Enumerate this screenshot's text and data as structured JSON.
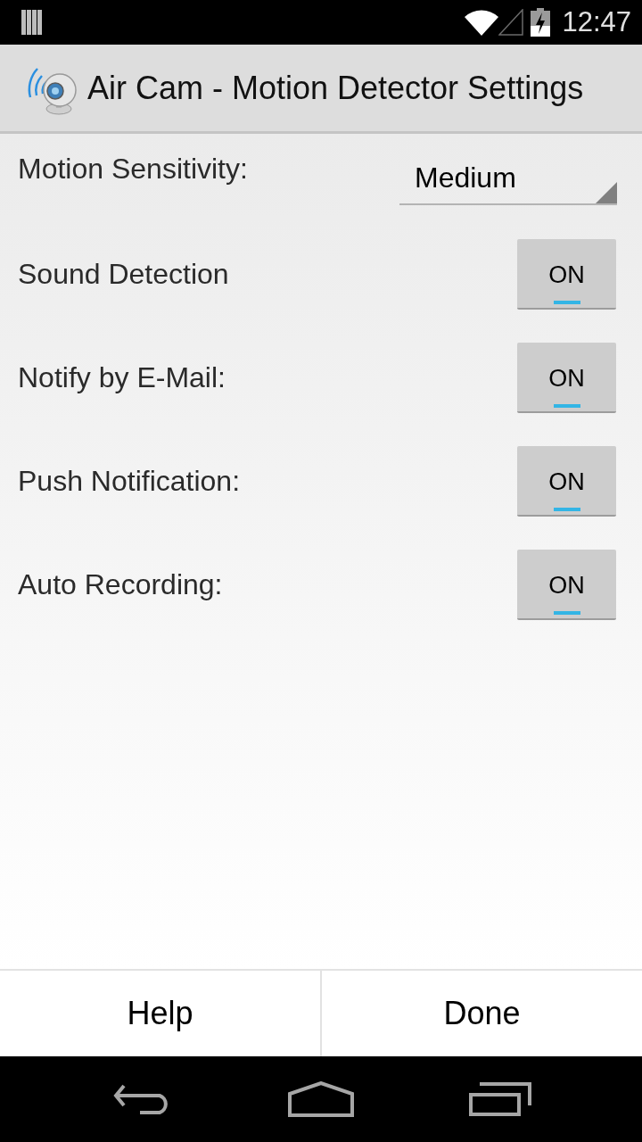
{
  "status_bar": {
    "time": "12:47"
  },
  "title_bar": {
    "title": "Air Cam - Motion Detector Settings"
  },
  "settings": [
    {
      "kind": "spinner",
      "label": "Motion Sensitivity:",
      "value": "Medium"
    },
    {
      "kind": "toggle",
      "label": "Sound Detection",
      "text": "ON",
      "on": true
    },
    {
      "kind": "toggle",
      "label": "Notify by E-Mail:",
      "text": "ON",
      "on": true
    },
    {
      "kind": "toggle",
      "label": "Push Notification:",
      "text": "ON",
      "on": true
    },
    {
      "kind": "toggle",
      "label": "Auto Recording:",
      "text": "ON",
      "on": true
    }
  ],
  "buttons": [
    "Help",
    "Done"
  ]
}
